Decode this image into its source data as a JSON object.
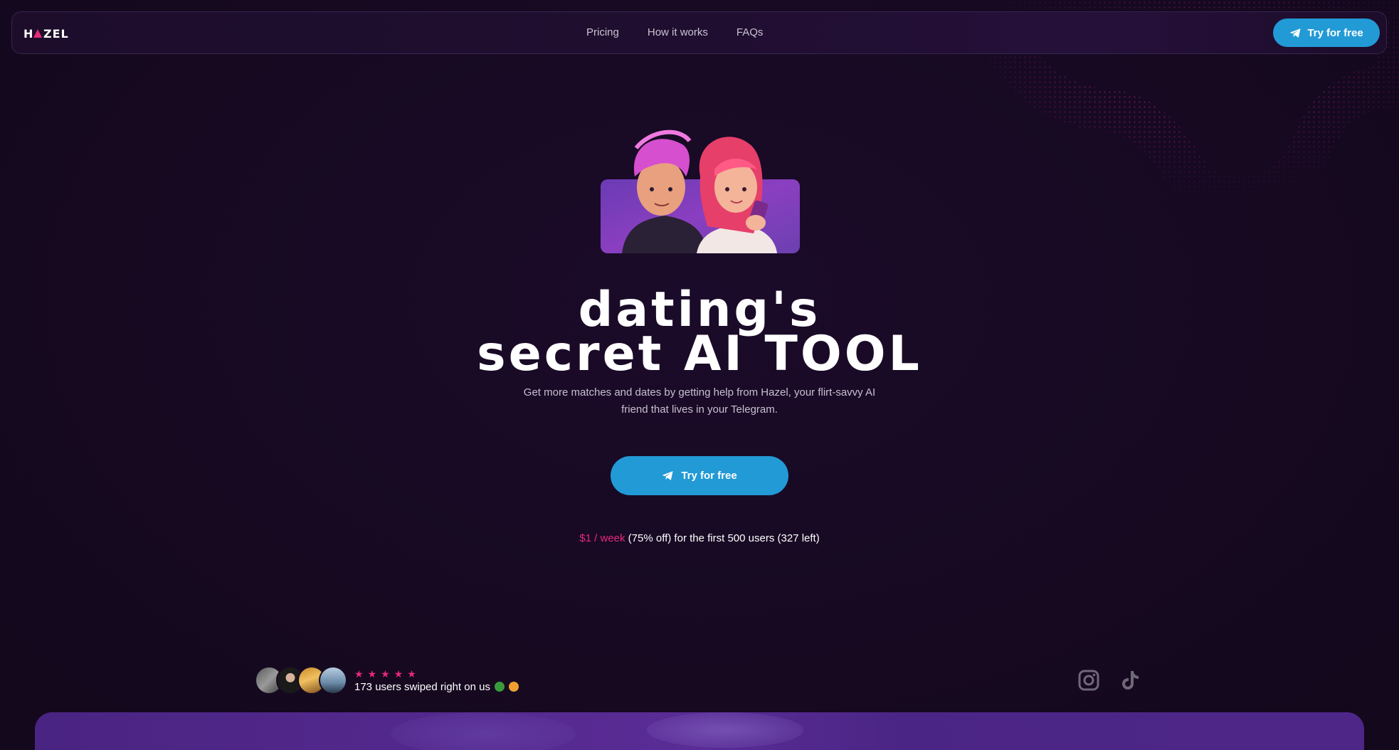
{
  "nav": {
    "logo": "HAZEL",
    "links": [
      "Pricing",
      "How it works",
      "FAQs"
    ],
    "cta_label": "Try for free"
  },
  "hero": {
    "headline_line1": "dating's",
    "headline_line2_a": "secret",
    "headline_line2_b": "AI TOOL",
    "subtitle": "Get more matches and dates by getting help from  Hazel, your flirt-savvy AI friend that lives in your Telegram.",
    "cta_label": "Try for free",
    "offer_price": "$1 / week",
    "offer_rest": " (75% off) for the first 500 users (327 left)"
  },
  "social_proof": {
    "stars": [
      "★",
      "★",
      "★",
      "★",
      "★"
    ],
    "text": "173 users swiped right on us",
    "socials": [
      "instagram-icon",
      "tiktok-icon"
    ]
  },
  "colors": {
    "accent_blue": "#229ad6",
    "accent_pink": "#e6297a",
    "background": "#170a22"
  }
}
